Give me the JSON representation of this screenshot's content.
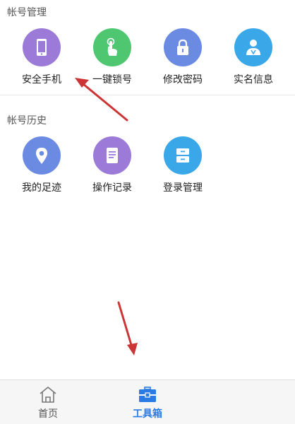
{
  "colors": {
    "purple": "#9b7ad8",
    "green": "#4fc770",
    "blue_violet": "#6b8be3",
    "sky": "#3aa7e8",
    "accent": "#2b7be4",
    "arrow": "#cc3535"
  },
  "account_management": {
    "title": "帐号管理",
    "items": [
      {
        "label": "安全手机",
        "icon": "phone-icon"
      },
      {
        "label": "一键锁号",
        "icon": "tap-hand-icon"
      },
      {
        "label": "修改密码",
        "icon": "lock-icon"
      },
      {
        "label": "实名信息",
        "icon": "id-card-icon"
      }
    ]
  },
  "account_history": {
    "title": "帐号历史",
    "items": [
      {
        "label": "我的足迹",
        "icon": "location-pin-icon"
      },
      {
        "label": "操作记录",
        "icon": "document-icon"
      },
      {
        "label": "登录管理",
        "icon": "drawer-icon"
      }
    ]
  },
  "tabbar": {
    "home_label": "首页",
    "toolbox_label": "工具箱",
    "active_tab": "toolbox"
  }
}
